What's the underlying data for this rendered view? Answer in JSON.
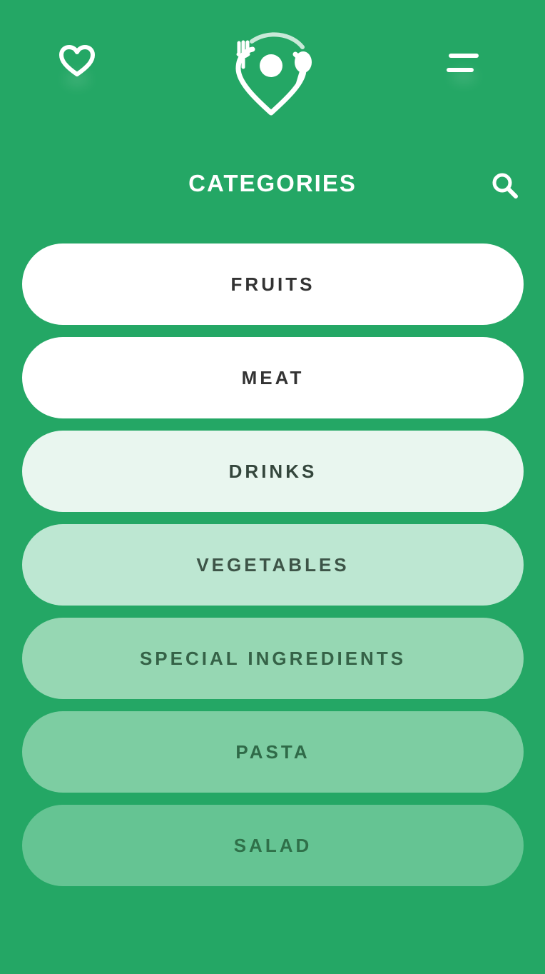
{
  "header": {
    "favorites_icon": "heart-outline-icon",
    "logo_icon": "location-pin-fork-spoon-logo",
    "menu_icon": "hamburger-menu-icon"
  },
  "title_row": {
    "title": "CATEGORIES",
    "search_icon": "search-icon"
  },
  "categories": [
    {
      "label": "FRUITS",
      "bg": "#ffffff",
      "color": "#333333"
    },
    {
      "label": "MEAT",
      "bg": "#ffffff",
      "color": "#333333"
    },
    {
      "label": "DRINKS",
      "bg": "#e9f6ef",
      "color": "#34463c"
    },
    {
      "label": "VEGETABLES",
      "bg": "#bde7d2",
      "color": "#3d5447"
    },
    {
      "label": "SPECIAL INGREDIENTS",
      "bg": "#96d7b3",
      "color": "#356247"
    },
    {
      "label": "PASTA",
      "bg": "#7dcda2",
      "color": "#2f6a48"
    },
    {
      "label": "SALAD",
      "bg": "#65c493",
      "color": "#2f7049"
    }
  ],
  "colors": {
    "background": "#24a765",
    "icon": "#ffffff"
  }
}
